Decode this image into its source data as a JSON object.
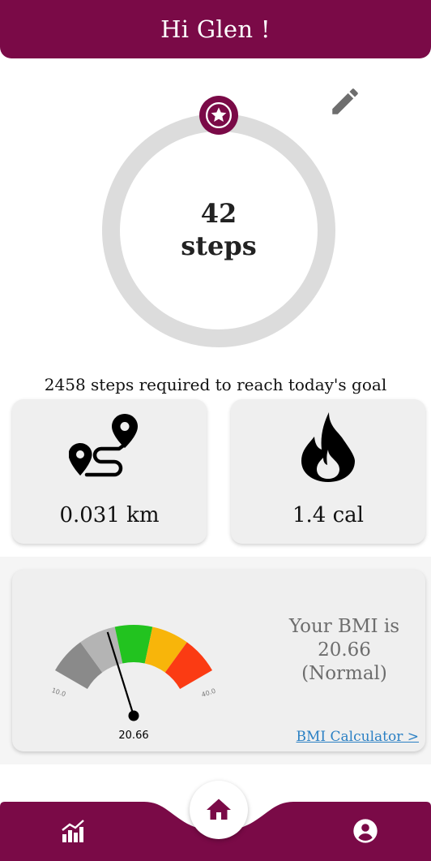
{
  "header": {
    "title": "Hi Glen !"
  },
  "steps": {
    "count": "42",
    "unit": "steps",
    "goal_message": "2458 steps required to reach today's goal",
    "progress_fraction": 0.017
  },
  "stats": {
    "distance": {
      "value": "0.031 km",
      "icon": "route-icon"
    },
    "calories": {
      "value": "1.4 cal",
      "icon": "flame-icon"
    }
  },
  "bmi": {
    "line1": "Your BMI is",
    "value": "20.66",
    "category": "(Normal)",
    "gauge_min_label": "10.0",
    "gauge_max_label": "40.0",
    "gauge_min": 10.0,
    "gauge_max": 40.0,
    "gauge_value": 20.66,
    "pointer_label": "20.66",
    "calculator_link": "BMI Calculator >"
  },
  "nav": {
    "left_icon": "bar-chart-icon",
    "center_icon": "home-icon",
    "right_icon": "account-icon"
  },
  "colors": {
    "brand": "#7a0a47",
    "ring_track": "#dcdcdc",
    "gauge_segments": [
      "#8a8a8a",
      "#b4b4b4",
      "#22c31f",
      "#f8b50a",
      "#fb3b13"
    ],
    "link": "#2b80c4"
  }
}
